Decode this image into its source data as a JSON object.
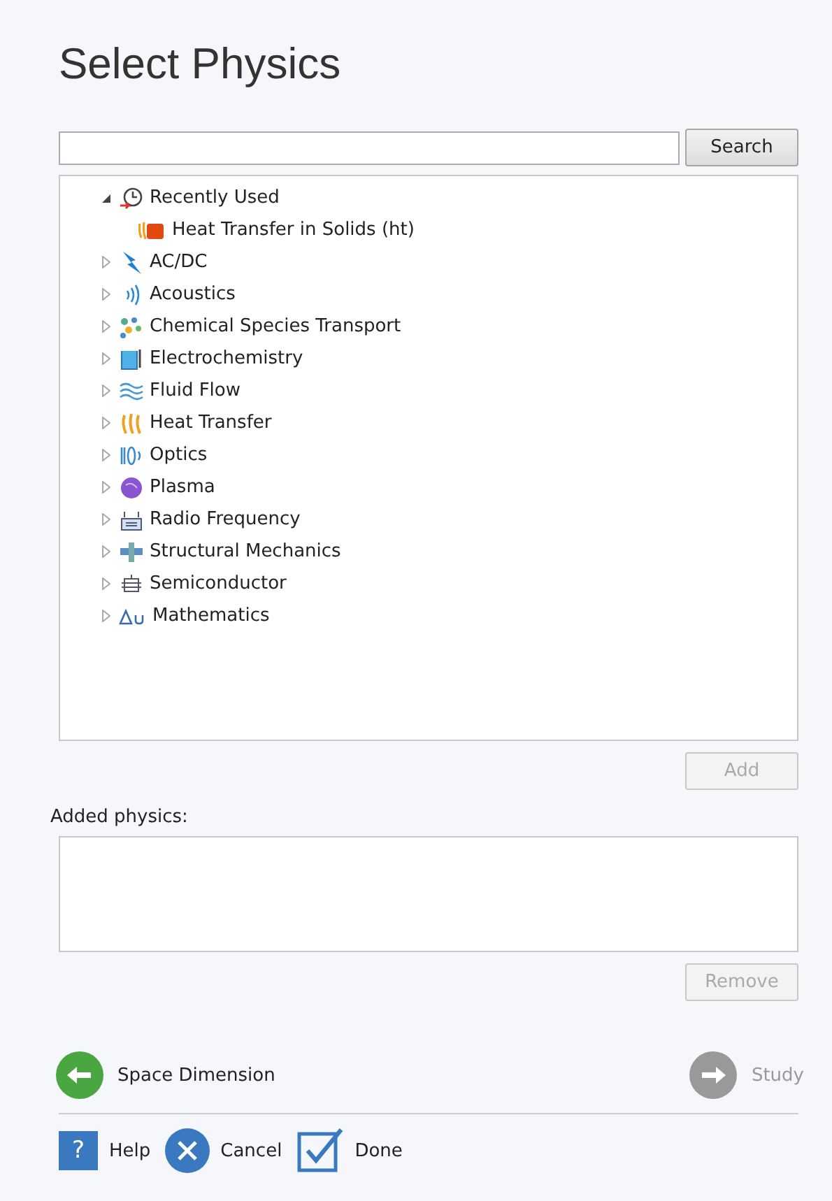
{
  "title": "Select Physics",
  "search": {
    "button": "Search"
  },
  "tree": [
    {
      "label": "Recently Used",
      "expanded": true,
      "children": [
        {
          "label": "Heat Transfer in Solids (ht)"
        }
      ]
    },
    {
      "label": "AC/DC",
      "expanded": false
    },
    {
      "label": "Acoustics",
      "expanded": false
    },
    {
      "label": "Chemical Species Transport",
      "expanded": false
    },
    {
      "label": "Electrochemistry",
      "expanded": false
    },
    {
      "label": "Fluid Flow",
      "expanded": false
    },
    {
      "label": "Heat Transfer",
      "expanded": false
    },
    {
      "label": "Optics",
      "expanded": false
    },
    {
      "label": "Plasma",
      "expanded": false
    },
    {
      "label": "Radio Frequency",
      "expanded": false
    },
    {
      "label": "Structural Mechanics",
      "expanded": false
    },
    {
      "label": "Semiconductor",
      "expanded": false
    },
    {
      "label": "Mathematics",
      "expanded": false
    }
  ],
  "add_button": {
    "label": "Add",
    "disabled": true
  },
  "added_physics": {
    "label": "Added physics:"
  },
  "remove_button": {
    "label": "Remove",
    "disabled": true
  },
  "nav": {
    "back": {
      "label": "Space Dimension",
      "disabled": false
    },
    "next": {
      "label": "Study",
      "disabled": true
    }
  },
  "footer": {
    "help_glyph": "?",
    "help": "Help",
    "cancel": "Cancel",
    "done": "Done"
  }
}
